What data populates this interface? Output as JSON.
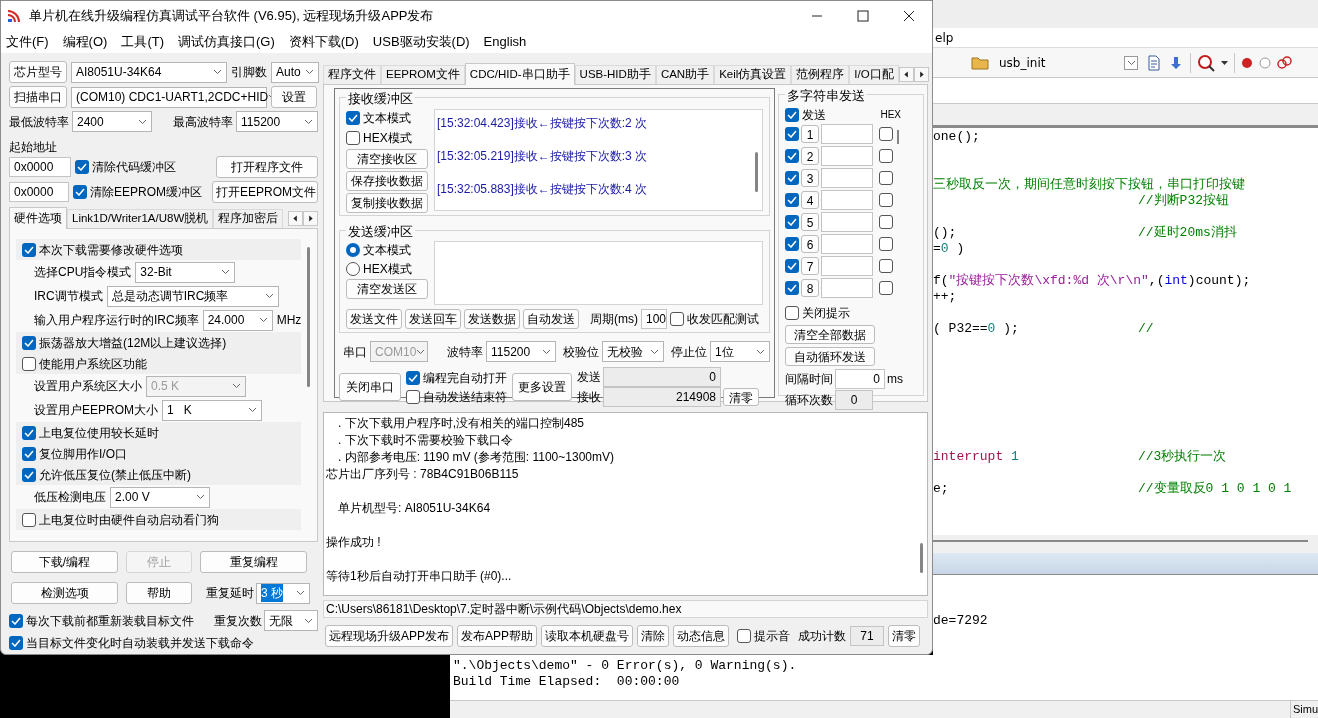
{
  "window": {
    "title": "单片机在线升级编程仿真调试平台软件 (V6.95), 远程现场升级APP发布"
  },
  "menu": [
    "文件(F)",
    "编程(O)",
    "工具(T)",
    "调试仿真接口(G)",
    "资料下载(D)",
    "USB驱动安装(D)",
    "English"
  ],
  "chip": {
    "button": "芯片型号",
    "value": "AI8051U-34K64",
    "pins_label": "引脚数",
    "pins": "Auto"
  },
  "port": {
    "button": "扫描串口",
    "value": "(COM10) CDC1-UART1,2CDC+HID",
    "settings": "设置"
  },
  "baud": {
    "min_label": "最低波特率",
    "min": "2400",
    "max_label": "最高波特率",
    "max": "115200"
  },
  "start_address": {
    "label": "起始地址",
    "code": "0x0000",
    "eeprom": "0x0000"
  },
  "clear_code": {
    "label": "清除代码缓冲区",
    "checked": true
  },
  "clear_eeprom": {
    "label": "清除EEPROM缓冲区",
    "checked": true
  },
  "open_program": "打开程序文件",
  "open_eeprom": "打开EEPROM文件",
  "left_tabs": [
    {
      "label": "硬件选项",
      "selected": true
    },
    {
      "label": "Link1D/Writer1A/U8W脱机",
      "selected": false
    },
    {
      "label": "程序加密后",
      "selected": false
    }
  ],
  "hardware_options": [
    {
      "kind": "check",
      "label": "本次下载需要修改硬件选项",
      "checked": true
    },
    {
      "kind": "select",
      "label": "选择CPU指令模式",
      "value": "32-Bit",
      "disabled": false
    },
    {
      "kind": "select",
      "label": "IRC调节模式",
      "value": "总是动态调节IRC频率",
      "disabled": false
    },
    {
      "kind": "select",
      "label": "输入用户程序运行时的IRC频率",
      "value": "24.000",
      "unit": "MHz",
      "disabled": false
    },
    {
      "kind": "check",
      "label": "振荡器放大增益(12M以上建议选择)",
      "checked": true
    },
    {
      "kind": "check",
      "label": "使能用户系统区功能",
      "checked": false
    },
    {
      "kind": "select",
      "label": "设置用户系统区大小",
      "value": "0.5 K",
      "disabled": true
    },
    {
      "kind": "select",
      "label": "设置用户EEPROM大小",
      "value": "1   K",
      "disabled": false
    },
    {
      "kind": "check",
      "label": "上电复位使用较长延时",
      "checked": true
    },
    {
      "kind": "check",
      "label": "复位脚用作I/O口",
      "checked": true
    },
    {
      "kind": "check",
      "label": "允许低压复位(禁止低压中断)",
      "checked": true
    },
    {
      "kind": "select",
      "label": "低压检测电压",
      "value": "2.00 V",
      "disabled": false
    },
    {
      "kind": "check",
      "label": "上电复位时由硬件自动启动看门狗",
      "checked": false
    }
  ],
  "action_buttons": [
    {
      "label": "下载/编程",
      "disabled": false
    },
    {
      "label": "停止",
      "disabled": true
    },
    {
      "label": "重复编程",
      "disabled": false
    }
  ],
  "option_buttons": [
    {
      "label": "检测选项",
      "disabled": false
    },
    {
      "label": "帮助",
      "disabled": false
    }
  ],
  "repeat_delay": {
    "label": "重复延时",
    "value": "3 秒",
    "highlighted": true
  },
  "repeat_count": {
    "label": "重复次数",
    "value": "无限",
    "highlighted": false
  },
  "reload_checks": [
    {
      "label": "每次下载前都重新装载目标文件",
      "checked": true
    },
    {
      "label": "当目标文件变化时自动装载并发送下载命令",
      "checked": true
    }
  ],
  "right_tabs": [
    {
      "label": "程序文件",
      "selected": false
    },
    {
      "label": "EEPROM文件",
      "selected": false
    },
    {
      "label": "CDC/HID-串口助手",
      "selected": true
    },
    {
      "label": "USB-HID助手",
      "selected": false
    },
    {
      "label": "CAN助手",
      "selected": false
    },
    {
      "label": "Keil仿真设置",
      "selected": false
    },
    {
      "label": "范例程序",
      "selected": false
    },
    {
      "label": "I/O口配",
      "selected": false
    }
  ],
  "receive": {
    "title": "接收缓冲区",
    "modes": [
      {
        "label": "文本模式",
        "checked": true
      },
      {
        "label": "HEX模式",
        "checked": false
      }
    ],
    "buttons": [
      "清空接收区",
      "保存接收数据",
      "复制接收数据"
    ],
    "lines": [
      "[15:32:04.423]接收←按键按下次数:2 次",
      "[15:32:05.219]接收←按键按下次数:3 次",
      "[15:32:05.883]接收←按键按下次数:4 次"
    ]
  },
  "send": {
    "title": "发送缓冲区",
    "modes": [
      {
        "label": "文本模式",
        "selected": true
      },
      {
        "label": "HEX模式",
        "selected": false
      }
    ],
    "clear": "清空发送区",
    "buttons": [
      "发送文件",
      "发送回车",
      "发送数据",
      "自动发送"
    ],
    "period_label": "周期(ms)",
    "period": "100",
    "match_test": {
      "label": "收发匹配测试",
      "checked": false
    }
  },
  "serial": {
    "port_label": "串口",
    "port": "COM10",
    "baud_label": "波特率",
    "baud": "115200",
    "parity_label": "校验位",
    "parity": "无校验",
    "stop_label": "停止位",
    "stop": "1位",
    "close": "关闭串口",
    "auto_open": {
      "label": "编程完自动打开",
      "checked": true
    },
    "auto_end": {
      "label": "自动发送结束符",
      "checked": false
    },
    "more": "更多设置",
    "sent_label": "发送",
    "sent": "0",
    "recv_label": "接收",
    "recv": "214908",
    "reset": "清零"
  },
  "multi": {
    "title": "多字符串发送",
    "send": {
      "label": "发送",
      "checked": true
    },
    "hex_label": "HEX",
    "rows": [
      {
        "number": "1",
        "checked": true,
        "hex": false
      },
      {
        "number": "2",
        "checked": true,
        "hex": false
      },
      {
        "number": "3",
        "checked": true,
        "hex": false
      },
      {
        "number": "4",
        "checked": true,
        "hex": false
      },
      {
        "number": "5",
        "checked": true,
        "hex": false
      },
      {
        "number": "6",
        "checked": true,
        "hex": false
      },
      {
        "number": "7",
        "checked": true,
        "hex": false
      },
      {
        "number": "8",
        "checked": true,
        "hex": false
      }
    ],
    "close_tip": {
      "label": "关闭提示",
      "checked": false
    },
    "clear_all": "清空全部数据",
    "auto_loop": "自动循环发送",
    "interval_label": "间隔时间",
    "interval": "0",
    "interval_unit": "ms",
    "loop_label": "循环次数",
    "loop": "0"
  },
  "log": [
    {
      "kind": "bullet",
      "text": ". 下次下载用户程序时,没有相关的端口控制485"
    },
    {
      "kind": "bullet",
      "text": ". 下次下载时不需要校验下载口令"
    },
    {
      "kind": "bullet",
      "text": ". 内部参考电压: 1190 mV (参考范围: 1100~1300mV)"
    },
    {
      "kind": "plain",
      "text": "芯片出厂序列号 : 78B4C91B06B115"
    },
    {
      "kind": "blank"
    },
    {
      "kind": "indent",
      "text": "单片机型号: AI8051U-34K64"
    },
    {
      "kind": "blank"
    },
    {
      "kind": "plain",
      "text": "操作成功 !"
    },
    {
      "kind": "blank"
    },
    {
      "kind": "plain",
      "text": "等待1秒后自动打开串口助手 (#0)..."
    }
  ],
  "path": "C:\\Users\\86181\\Desktop\\7.定时器中断\\示例代码\\Objects\\demo.hex",
  "bottom_buttons": [
    "远程现场升级APP发布",
    "发布APP帮助",
    "读取本机硬盘号",
    "清除",
    "动态信息"
  ],
  "sound": {
    "label": "提示音",
    "checked": false
  },
  "success_label": "成功计数",
  "success": "71",
  "success_reset": "清零",
  "ide": {
    "menu": "elp",
    "function": "usb_init",
    "code": [
      {
        "kind": "line",
        "segments": [
          {
            "kind": "text",
            "text": "one();"
          }
        ]
      },
      {
        "kind": "blank"
      },
      {
        "kind": "blank"
      },
      {
        "kind": "line",
        "segments": [
          {
            "kind": "comment",
            "text": "三秒取反一次，期间任意时刻按下按钮，串口打印按键"
          }
        ]
      },
      {
        "kind": "line",
        "comment": "//判断P32按钮"
      },
      {
        "kind": "blank"
      },
      {
        "kind": "line",
        "segments": [
          {
            "kind": "text",
            "text": "();"
          }
        ],
        "comment": "//延时20ms消抖"
      },
      {
        "kind": "line",
        "segments": [
          {
            "kind": "text",
            "text": "="
          },
          {
            "kind": "number",
            "text": "0"
          },
          {
            "kind": "text",
            "text": " )"
          }
        ]
      },
      {
        "kind": "blank"
      },
      {
        "kind": "line",
        "segments": [
          {
            "kind": "text",
            "text": "f("
          },
          {
            "kind": "string",
            "text": "\"按键按下次数\\xfd:%d 次\\r\\n\""
          },
          {
            "kind": "text",
            "text": ",("
          },
          {
            "kind": "type",
            "text": "int"
          },
          {
            "kind": "text",
            "text": ")count);"
          }
        ]
      },
      {
        "kind": "line",
        "segments": [
          {
            "kind": "text",
            "text": "++;"
          }
        ]
      },
      {
        "kind": "blank"
      },
      {
        "kind": "line",
        "segments": [
          {
            "kind": "text",
            "text": "( P32=="
          },
          {
            "kind": "number",
            "text": "0"
          },
          {
            "kind": "text",
            "text": " );"
          }
        ],
        "comment": "//"
      },
      {
        "kind": "blank"
      },
      {
        "kind": "blank"
      },
      {
        "kind": "blank"
      },
      {
        "kind": "blank"
      },
      {
        "kind": "blank"
      },
      {
        "kind": "blank"
      },
      {
        "kind": "blank"
      },
      {
        "kind": "line",
        "segments": [
          {
            "kind": "keyword",
            "text": "interrupt"
          },
          {
            "kind": "number",
            "text": " 1"
          }
        ],
        "comment": "//3秒执行一次"
      },
      {
        "kind": "blank"
      },
      {
        "kind": "line",
        "segments": [
          {
            "kind": "text",
            "text": "e;"
          }
        ],
        "comment": "//变量取反0 1 0 1 0 1"
      }
    ],
    "output": [
      "de=7292"
    ],
    "build": [
      "\".\\Objects\\demo\" - 0 Error(s), 0 Warning(s).",
      "Build Time Elapsed:  00:00:00"
    ],
    "status": "Simu"
  }
}
